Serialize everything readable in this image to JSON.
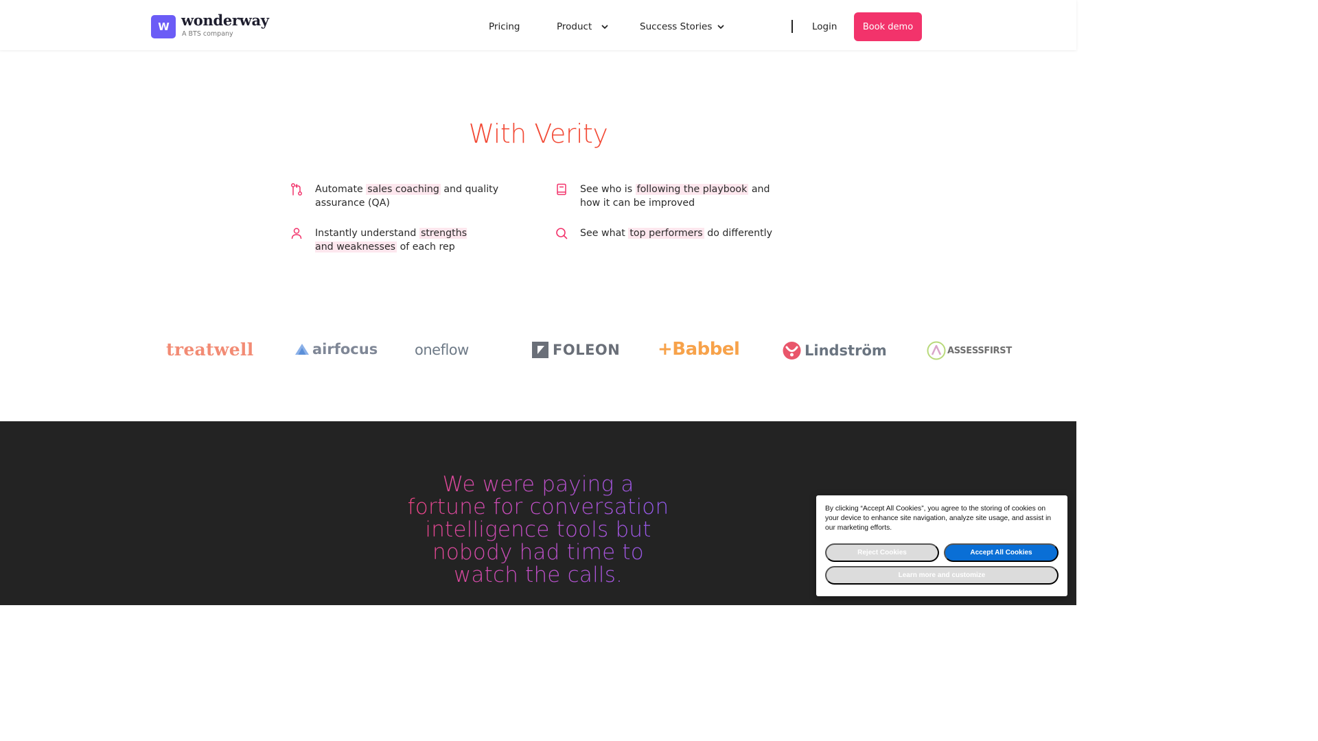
{
  "header": {
    "logo_mark": "W",
    "brand_name": "wonderway",
    "brand_tagline": "A BTS company",
    "nav": {
      "pricing": "Pricing",
      "product": "Product",
      "success_stories": "Success Stories",
      "login": "Login",
      "book_demo": "Book demo"
    }
  },
  "verity": {
    "title": "With Verity",
    "features": [
      {
        "icon": "git-pull-icon",
        "pre": "Automate ",
        "highlight": "sales coaching",
        "post": " and quality assurance (QA)"
      },
      {
        "icon": "book-icon",
        "pre": "See who is ",
        "highlight": "following the playbook",
        "post": " and how it can be improved"
      },
      {
        "icon": "user-icon",
        "pre": "Instantly understand ",
        "highlight": "strengths and weaknesses",
        "post": " of each rep"
      },
      {
        "icon": "search-icon",
        "pre": "See what ",
        "highlight": "top performers",
        "post": " do differently"
      }
    ]
  },
  "customers": {
    "treatwell": "treatwell",
    "airfocus": "airfocus",
    "oneflow": "oneflow",
    "foleon": "FOLEON",
    "babbel": "+Babbel",
    "lindstrom": "Lindström",
    "assessfirst": "ASSESSFIRST"
  },
  "testimonial": {
    "quote": "We were paying a fortune for conversation intelligence tools but nobody had time to watch the calls."
  },
  "cookie_banner": {
    "text": "By clicking “Accept All Cookies”, you agree to the storing of cookies on your device to enhance site navigation, analyze site usage, and assist in our marketing efforts.",
    "reject": "Reject Cookies",
    "accept": "Accept All Cookies",
    "customize": "Learn more and customize"
  },
  "colors": {
    "brand_purple": "#6b5cf6",
    "cta_pink": "#f2336b",
    "title_orange": "#f24a36",
    "highlight_bg": "#fde7ee",
    "dark_bg": "#232323",
    "cookie_accept_blue": "#0a6fd6"
  }
}
